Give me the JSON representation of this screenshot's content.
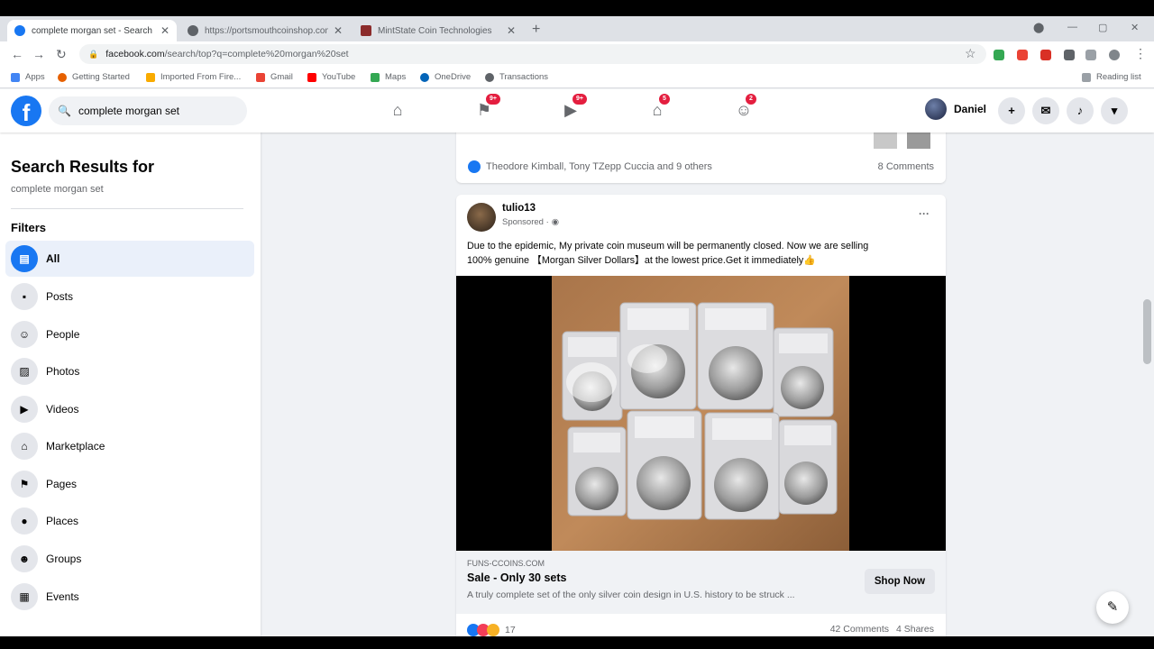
{
  "browser": {
    "tabs": [
      {
        "title": "complete morgan set - Search R",
        "color": "#1877f2"
      },
      {
        "title": "https://portsmouthcoinshop.com",
        "color": "#5f6368"
      },
      {
        "title": "MintState Coin Technologies",
        "color": "#8b2b2b"
      }
    ],
    "new_tab": "+",
    "url_host": "facebook.com",
    "url_path": "/search/top?q=complete%20morgan%20set",
    "bookmarks": [
      "Apps",
      "Getting Started",
      "Imported From Fire...",
      "Gmail",
      "YouTube",
      "Maps",
      "OneDrive",
      "Transactions"
    ],
    "reading_list": "Reading list"
  },
  "header": {
    "logo": "f",
    "search_value": "complete morgan set",
    "badges": {
      "pages": "9+",
      "watch": "9+",
      "marketplace": "5",
      "groups": "2"
    },
    "user_name": "Daniel",
    "plus": "+"
  },
  "sidebar": {
    "title": "Search Results for",
    "query": "complete morgan set",
    "filters_label": "Filters",
    "items": [
      {
        "label": "All",
        "icon": "all-icon"
      },
      {
        "label": "Posts",
        "icon": "posts-icon"
      },
      {
        "label": "People",
        "icon": "people-icon"
      },
      {
        "label": "Photos",
        "icon": "photos-icon"
      },
      {
        "label": "Videos",
        "icon": "videos-icon"
      },
      {
        "label": "Marketplace",
        "icon": "marketplace-icon"
      },
      {
        "label": "Pages",
        "icon": "pages-icon"
      },
      {
        "label": "Places",
        "icon": "places-icon"
      },
      {
        "label": "Groups",
        "icon": "groups-icon"
      },
      {
        "label": "Events",
        "icon": "events-icon"
      }
    ]
  },
  "prev_post": {
    "reactors": "Theodore Kimball, Tony TZepp Cuccia and 9 others",
    "comments": "8 Comments"
  },
  "post": {
    "author": "tulio13",
    "sponsored": "Sponsored ·",
    "more": "···",
    "text_line1": "Due to the epidemic, My private coin museum will be permanently closed. Now we are selling",
    "text_line2": "100% genuine 【Morgan Silver Dollars】at the lowest price.Get it immediately👍",
    "link_domain": "FUNS-CCOINS.COM",
    "link_title": "Sale - Only 30 sets",
    "link_desc": "A truly complete set of the only silver coin design in U.S. history to be struck ...",
    "cta": "Shop Now",
    "reaction_count": "17",
    "comments": "42 Comments",
    "shares": "4 Shares"
  }
}
